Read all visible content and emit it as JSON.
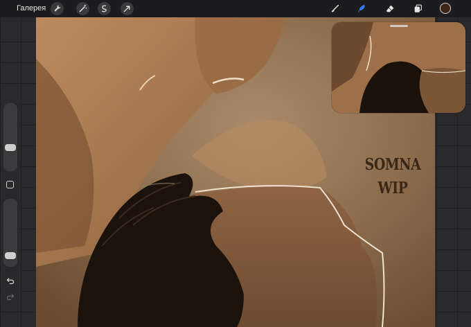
{
  "toolbar": {
    "gallery_label": "Галерея",
    "left_tools": [
      "wrench-icon",
      "magic-wand-icon",
      "selection-icon",
      "transform-arrow-icon"
    ],
    "right_tools": [
      "brush-icon",
      "smudge-icon",
      "eraser-icon",
      "layers-icon"
    ],
    "active_tool": "smudge-icon",
    "active_color": "#3d2417",
    "accent": "#3478f6"
  },
  "canvas": {
    "watermark_line1": "SOMNA",
    "watermark_line2": "WIP",
    "background": "#7a5a3e"
  },
  "reference_window": {
    "visible": true
  },
  "sidebar": {
    "brush_size": 0.32,
    "opacity": 0.1,
    "undo_icon": "undo-icon",
    "redo_icon": "redo-icon",
    "modify_icon": "modify-square-icon"
  }
}
